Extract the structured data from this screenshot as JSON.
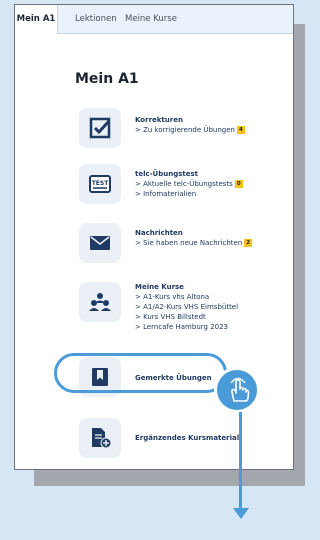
{
  "tabs": [
    {
      "label": "Mein A1"
    },
    {
      "label": "Lektionen"
    },
    {
      "label": "Meine Kurse"
    }
  ],
  "page_title": "Mein A1",
  "items": [
    {
      "title": "Korrekturen",
      "icon": "checkbox-icon",
      "links": [
        {
          "text": "> Zu korrigierende Übungen",
          "badge": "4"
        }
      ]
    },
    {
      "title": "telc-Übungstest",
      "icon": "test-sheet-icon",
      "links": [
        {
          "text": "> Aktuelle telc-Übungstests",
          "badge": "0"
        },
        {
          "text": "> Infomaterialien",
          "badge": ""
        }
      ]
    },
    {
      "title": "Nachrichten",
      "icon": "envelope-icon",
      "links": [
        {
          "text": "> Sie haben neue Nachrichten",
          "badge": "2"
        }
      ]
    },
    {
      "title": "Meine Kurse",
      "icon": "people-icon",
      "links": [
        {
          "text": "> A1-Kurs vhs Altona",
          "badge": ""
        },
        {
          "text": "> A1/A2-Kurs VHS Eimsbüttel",
          "badge": ""
        },
        {
          "text": "> Kurs VHS Billstedt",
          "badge": ""
        },
        {
          "text": "> Lerncafe Hamburg 2023",
          "badge": ""
        }
      ]
    },
    {
      "title": "Gemerkte Übungen",
      "icon": "bookmark-icon",
      "links": []
    },
    {
      "title": "Ergänzendes Kursmaterial",
      "icon": "document-add-icon",
      "links": []
    }
  ],
  "colors": {
    "accent": "#4a9bd7",
    "badge": "#f4c21a",
    "text": "#1f3a63",
    "background": "#d7e6f4"
  },
  "gesture_icon": "tap-hand-icon",
  "arrow_icon": "arrow-down-icon"
}
